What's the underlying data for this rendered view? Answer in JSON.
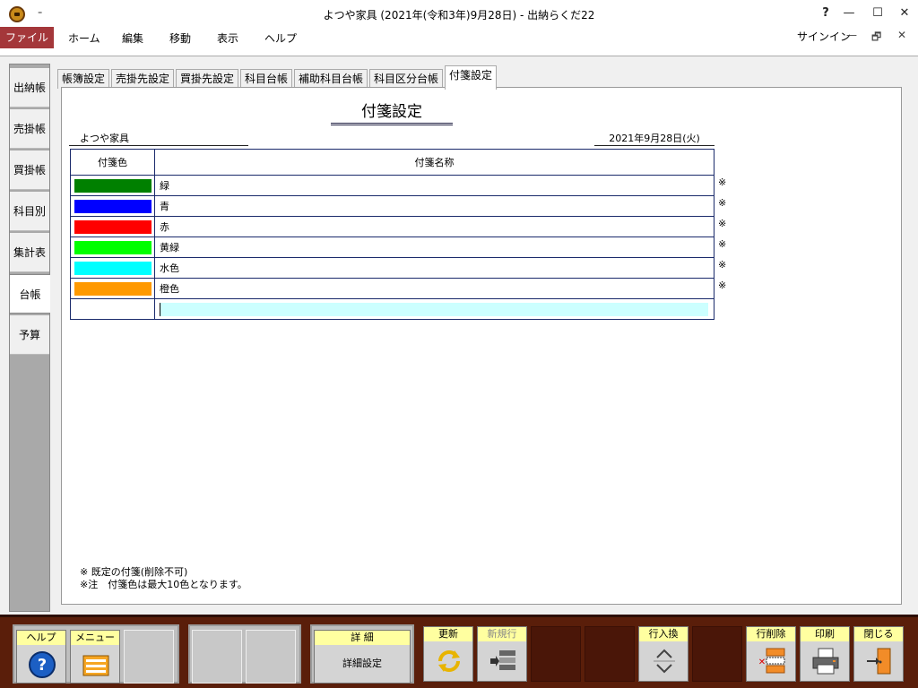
{
  "window": {
    "title": "よつや家具 (2021年(令和3年)9月28日) - 出納らくだ22",
    "qat": "₌",
    "help": "?",
    "minimize": "—",
    "maximize": "☐",
    "close": "✕"
  },
  "menu": {
    "items": [
      "ファイル",
      "ホーム",
      "編集",
      "移動",
      "表示",
      "ヘルプ"
    ],
    "signin": "サインイン",
    "sub_minimize": "—",
    "sub_restore": "🗗",
    "sub_close": "✕"
  },
  "sidebar": {
    "items": [
      {
        "label": "出納帳"
      },
      {
        "label": "売掛帳"
      },
      {
        "label": "買掛帳"
      },
      {
        "label": "科目別"
      },
      {
        "label": "集計表"
      },
      {
        "label": "台帳",
        "active": true
      },
      {
        "label": "予算"
      }
    ]
  },
  "tabs": [
    "帳簿設定",
    "売掛先設定",
    "買掛先設定",
    "科目台帳",
    "補助科目台帳",
    "科目区分台帳",
    "付箋設定"
  ],
  "active_tab": "付箋設定",
  "page": {
    "title": "付箋設定",
    "company": "よつや家具",
    "date": "2021年9月28日(火)",
    "table_headers": [
      "付箋色",
      "付箋名称"
    ],
    "rows": [
      {
        "color": "#008000",
        "name": "緑",
        "mark": "※"
      },
      {
        "color": "#0000ff",
        "name": "青",
        "mark": "※"
      },
      {
        "color": "#ff0000",
        "name": "赤",
        "mark": "※"
      },
      {
        "color": "#00ff00",
        "name": "黄緑",
        "mark": "※"
      },
      {
        "color": "#00ffff",
        "name": "水色",
        "mark": "※"
      },
      {
        "color": "#ff9900",
        "name": "橙色",
        "mark": "※"
      }
    ],
    "new_row_value": "",
    "notes": [
      "※ 既定の付箋(削除不可)",
      "※注　付箋色は最大10色となります。"
    ]
  },
  "toolbar": {
    "help": "ヘルプ",
    "menu": "メニュー",
    "detail": "詳 細",
    "detail_sub": "詳細設定",
    "refresh": "更新",
    "new_row": "新規行",
    "swap_rows": "行入換",
    "delete_row": "行削除",
    "print": "印刷",
    "close": "閉じる"
  },
  "colors": {
    "file_menu": "#a4373a",
    "toolbar_bg": "#5a1e0a",
    "label_bg": "#ffffa0",
    "input_bg": "#ccffff"
  }
}
